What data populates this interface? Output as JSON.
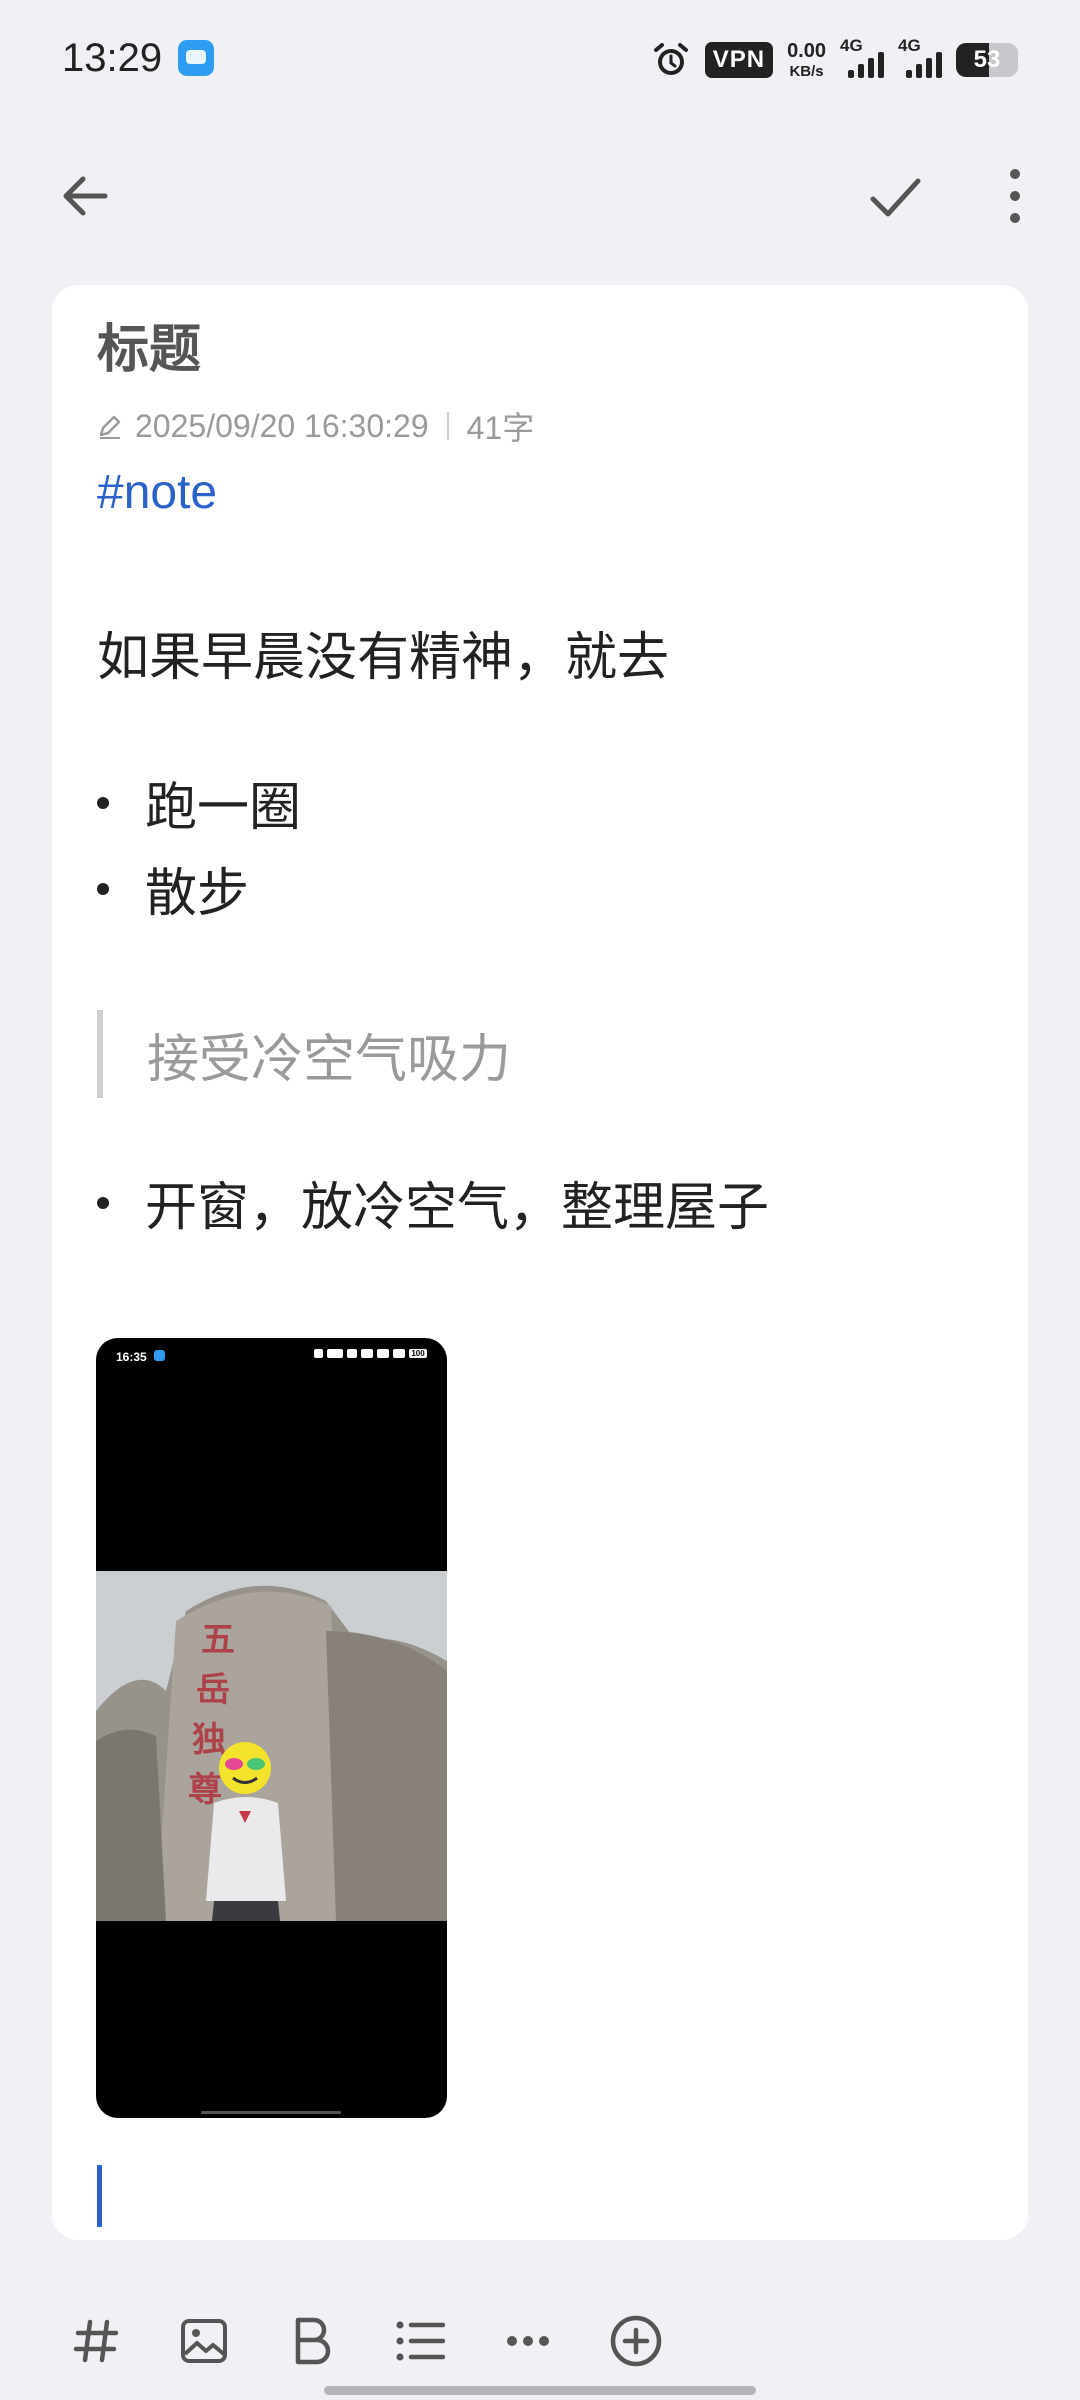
{
  "status_bar": {
    "time": "13:29",
    "app_icon": "notes-app-icon",
    "vpn": "VPN",
    "net_speed_value": "0.00",
    "net_speed_unit": "KB/s",
    "signal1_label": "4G",
    "signal2_label": "4G",
    "battery": "53",
    "battery_level": 0.53
  },
  "toolbar": {
    "back_icon": "arrow-left-icon",
    "save_icon": "check-icon",
    "more_icon": "more-vertical-icon"
  },
  "note": {
    "title": "标题",
    "timestamp": "2025/09/20 16:30:29",
    "word_count": "41字",
    "tag": "#note",
    "paragraph": "如果早晨没有精神，就去",
    "bullets_1": [
      "跑一圈",
      "散步"
    ],
    "quote": "接受冷空气吸力",
    "bullets_2": [
      "开窗，放冷空气，整理屋子"
    ],
    "image": {
      "status_time": "16:35",
      "battery": "100"
    }
  },
  "format_bar": {
    "items": [
      "hashtag-icon",
      "image-icon",
      "bold-icon",
      "list-icon",
      "more-horizontal-icon",
      "add-circle-icon"
    ]
  },
  "colors": {
    "background": "#f0f0f5",
    "card": "#ffffff",
    "tag": "#2a62c9",
    "cursor": "#2a62c9",
    "quote_text": "#9a9a9a"
  }
}
